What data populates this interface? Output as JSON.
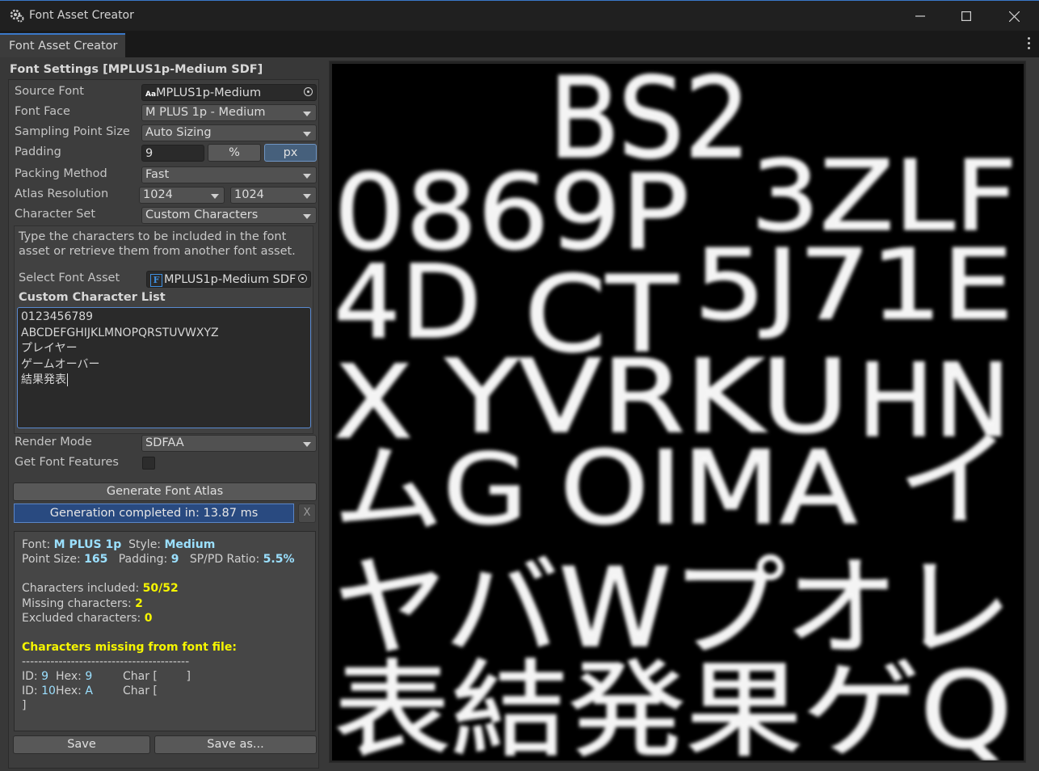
{
  "window": {
    "title": "Font Asset Creator",
    "tab": "Font Asset Creator"
  },
  "icons": {
    "app": "unity-gear-icon",
    "minimize": "minimize-icon",
    "maximize": "maximize-icon",
    "close": "close-icon",
    "menu": "kebab-menu-icon",
    "picker": "object-picker-icon"
  },
  "settings": {
    "title": "Font Settings [MPLUS1p-Medium SDF]",
    "source_font_label": "Source Font",
    "source_font_badge": "Aa",
    "source_font_value": "MPLUS1p-Medium",
    "font_face_label": "Font Face",
    "font_face_value": "M PLUS 1p - Medium",
    "sampling_label": "Sampling Point Size",
    "sampling_value": "Auto Sizing",
    "padding_label": "Padding",
    "padding_value": "9",
    "padding_percent": "%",
    "padding_px": "px",
    "packing_label": "Packing Method",
    "packing_value": "Fast",
    "atlas_label": "Atlas Resolution",
    "atlas_width": "1024",
    "atlas_height": "1024",
    "charset_label": "Character Set",
    "charset_value": "Custom Characters",
    "help_text": "Type the characters to be included in the font asset or retrieve them from another font asset.",
    "select_asset_label": "Select Font Asset",
    "select_asset_badge": "F",
    "select_asset_value": "MPLUS1p-Medium SDF",
    "custom_list_label": "Custom Character List",
    "custom_list_lines": [
      "0123456789",
      "ABCDEFGHIJKLMNOPQRSTUVWXYZ",
      "プレイヤー",
      "ゲームオーバー",
      "結果発表"
    ],
    "render_mode_label": "Render Mode",
    "render_mode_value": "SDFAA",
    "font_features_label": "Get Font Features"
  },
  "actions": {
    "generate_label": "Generate Font Atlas",
    "progress_text": "Generation completed in: 13.87 ms",
    "progress": 1.0,
    "dismiss_label": "X",
    "save_label": "Save",
    "save_as_label": "Save as..."
  },
  "report": {
    "font_key": "Font:",
    "font_val": "M PLUS 1p",
    "style_key": "Style:",
    "style_val": "Medium",
    "point_key": "Point Size:",
    "point_val": "165",
    "padding_key": "Padding:",
    "padding_val": "9",
    "ratio_key": "SP/PD Ratio:",
    "ratio_val": "5.5%",
    "included_key": "Characters included:",
    "included_val": "50/52",
    "missing_key": "Missing characters:",
    "missing_val": "2",
    "excluded_key": "Excluded characters:",
    "excluded_val": "0",
    "missing_title": "Characters missing from font file:",
    "divider": "-----------------------------------------",
    "row1_id_key": "ID:",
    "row1_id": "9",
    "row1_hex_key": "Hex:",
    "row1_hex": "9",
    "row1_char": "Char [        ]",
    "row2_id_key": "ID:",
    "row2_id": "10",
    "row2_hex_key": "Hex:",
    "row2_hex": "A",
    "row2_char": "Char [",
    "row2_close": "]"
  },
  "atlas_glyphs": {
    "row1": "BS2",
    "row2a": "0869P",
    "row2b": "3ZLF",
    "row3a": "4D",
    "row3b": "CT",
    "row3c": "5J71E",
    "row4a": "X",
    "row4b": "YVRKU",
    "row4c": "HN",
    "row5a": "ムG",
    "row5b": "OIMA",
    "row5c": "イ",
    "row6": "ヤバWプオレ",
    "row7": "表結発果ゲQ"
  }
}
